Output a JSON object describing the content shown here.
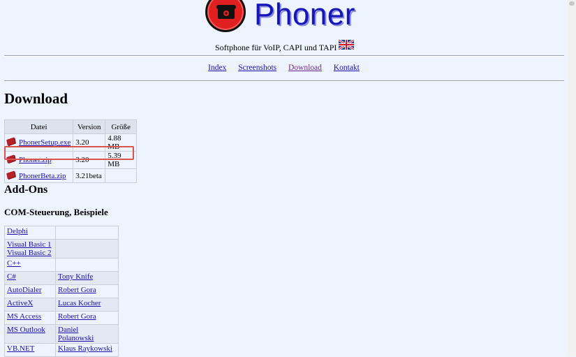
{
  "header": {
    "logo_text": "Phoner",
    "tagline": "Softphone für VoIP, CAPI und TAPI"
  },
  "nav": {
    "items": [
      "Index",
      "Screenshots",
      "Download",
      "Kontakt"
    ]
  },
  "page": {
    "title": "Download",
    "addons_title": "Add-Ons",
    "com_title": "COM-Steuerung, Beispiele"
  },
  "downloads": {
    "headers": [
      "Datei",
      "Version",
      "Größe"
    ],
    "rows": [
      {
        "file": "PhonerSetup.exe",
        "version": "3.20",
        "size": "4.88 MB"
      },
      {
        "file": "Phoner.zip",
        "version": "3.20",
        "size": "5.39 MB"
      },
      {
        "file": "PhonerBeta.zip",
        "version": "3.21beta",
        "size": ""
      }
    ]
  },
  "com_examples": {
    "rows": [
      {
        "lang": "Delphi",
        "author": ""
      },
      {
        "lang": "Visual Basic 1",
        "lang2": "Visual Basic 2",
        "author": ""
      },
      {
        "lang": "C++",
        "author": ""
      },
      {
        "lang": "C#",
        "author": "Tony Knife"
      },
      {
        "lang": "AutoDialer",
        "author": "Robert Gora"
      },
      {
        "lang": "ActiveX",
        "author": "Lucas Kocher"
      },
      {
        "lang": "MS Access",
        "author": "Robert Gora"
      },
      {
        "lang": "MS Outlook",
        "author": "Daniel Polanowski"
      },
      {
        "lang": "VB.NET",
        "author": "Klaus Raykowski"
      }
    ]
  },
  "colors": {
    "background": "#eef4fd",
    "link": "#1a0dab",
    "visited_link": "#6b2c83",
    "logo_text": "#1616b8",
    "logo_circle": "#e02020",
    "highlight_box": "#d9534f"
  }
}
